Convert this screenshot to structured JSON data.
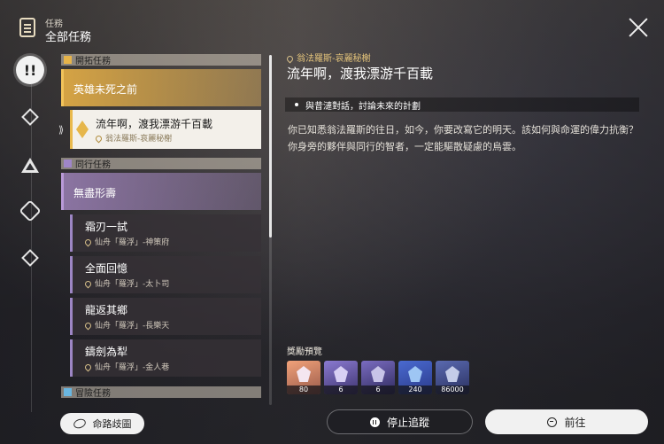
{
  "header": {
    "category_small": "任務",
    "title": "全部任務",
    "close_icon": "close-icon"
  },
  "sidebar": {
    "icons": [
      "quest-all-icon",
      "trailblaze-icon",
      "companion-icon",
      "adventure-icon",
      "daily-icon"
    ],
    "active_symbol": "!!"
  },
  "quest_list": {
    "sections": [
      {
        "title": "開拓任務",
        "icon": "trailblaze-section-icon"
      },
      {
        "title": "同行任務",
        "icon": "companion-section-icon"
      },
      {
        "title": "冒險任務",
        "icon": "adventure-section-icon"
      }
    ],
    "trailblaze_items": [
      {
        "title": "英雄未死之前"
      },
      {
        "title": "流年啊，渡我漂游千百載",
        "location": "翁法羅斯-哀麗秘榭"
      }
    ],
    "companion_items": [
      {
        "title": "無盡形壽"
      },
      {
        "title": "霜刃一試",
        "location": "仙舟「羅浮」-神策府"
      },
      {
        "title": "全面回憶",
        "location": "仙舟「羅浮」-太卜司"
      },
      {
        "title": "龍返其鄉",
        "location": "仙舟「羅浮」-長樂天"
      },
      {
        "title": "鑄劍為犁",
        "location": "仙舟「羅浮」-金人巷"
      }
    ],
    "map_button": "命路歧圖"
  },
  "detail": {
    "location": "翁法羅斯-哀麗秘榭",
    "title": "流年啊，渡我漂游千百載",
    "objective": "與昔漣對話，討論未來的計劃",
    "description": "你已知悉翁法羅斯的往日，如今，你要改寫它的明天。該如何與命運的偉力抗衡？你身旁的夥伴與同行的智者，一定能驅散疑慮的烏雲。",
    "rewards_label": "獎勵預覽",
    "rewards": [
      {
        "count": "80",
        "icon": "stellar-jade-icon"
      },
      {
        "count": "6",
        "icon": "lightcone-exp-icon"
      },
      {
        "count": "6",
        "icon": "trace-material-icon"
      },
      {
        "count": "240",
        "icon": "character-exp-icon"
      },
      {
        "count": "86000",
        "icon": "credit-icon"
      }
    ],
    "stop_button": "停止追蹤",
    "go_button": "前往"
  }
}
